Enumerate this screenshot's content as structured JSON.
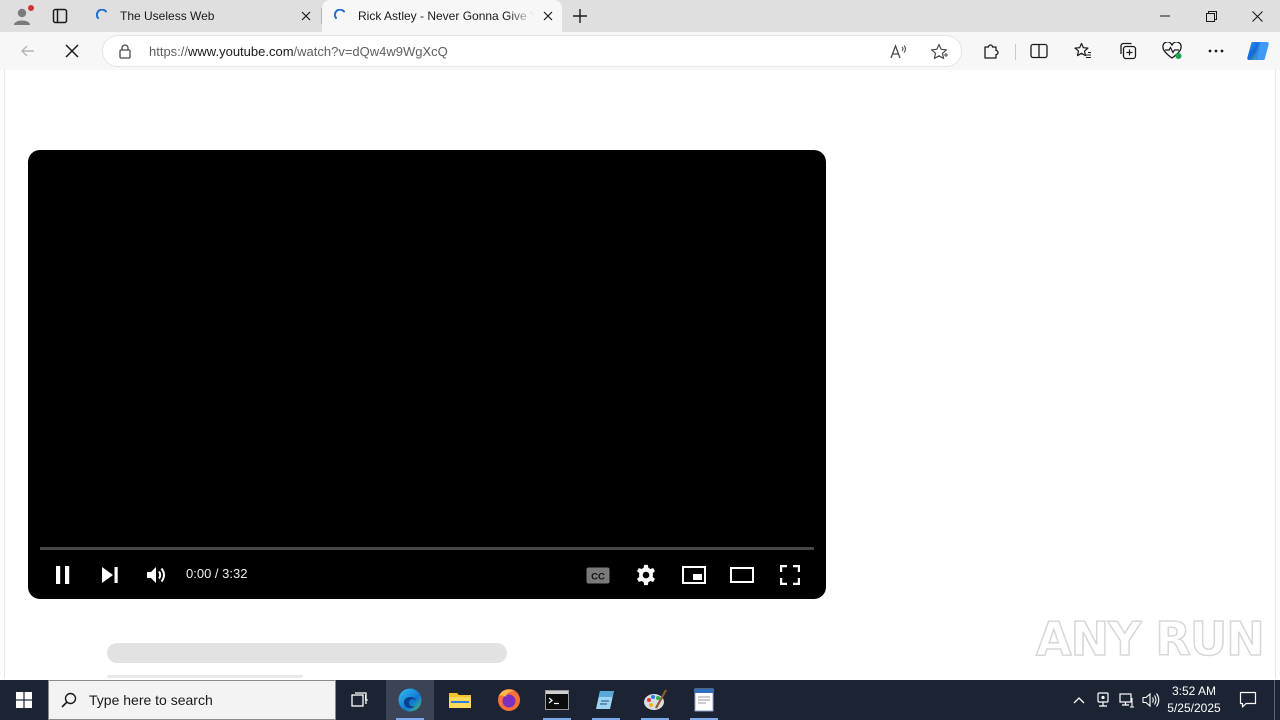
{
  "browser": {
    "tabs": [
      {
        "title": "The Useless Web"
      },
      {
        "title": "Rick Astley - Never Gonna Give You Up"
      }
    ],
    "address": {
      "scheme": "https://",
      "host": "www.youtube.com",
      "path": "/watch?v=dQw4w9WgXcQ"
    }
  },
  "player": {
    "time": "0:00 / 3:32",
    "progress_fraction": 0,
    "accent_color": "#ff0000",
    "controls": [
      "pause-icon",
      "next-icon",
      "volume-icon",
      "captions-icon",
      "settings-icon",
      "miniplayer-icon",
      "theater-icon",
      "fullscreen-icon"
    ]
  },
  "watermark": {
    "text": "ANY RUN"
  },
  "taskbar": {
    "search_placeholder": "Type here to search",
    "apps": [
      "task-view-icon",
      "edge-icon",
      "file-explorer-icon",
      "firefox-icon",
      "terminal-icon",
      "notepad-icon",
      "paint-icon",
      "document-icon"
    ],
    "clock_time": "3:52 AM",
    "clock_date": "5/25/2025"
  }
}
